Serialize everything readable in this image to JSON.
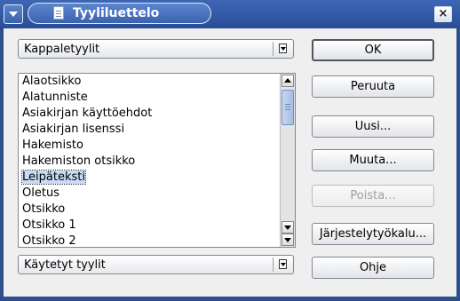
{
  "window": {
    "title": "Tyyliluettelo",
    "close_glyph": "×",
    "icons": {
      "menu": "chevron-down-icon",
      "title": "document-icon",
      "close": "close-icon"
    }
  },
  "style_family": {
    "selected": "Kappaletyylit",
    "icon": "dropdown-arrow-icon"
  },
  "style_list": {
    "items": [
      "Alaotsikko",
      "Alatunniste",
      "Asiakirjan käyttöehdot",
      "Asiakirjan lisenssi",
      "Hakemisto",
      "Hakemiston otsikko",
      "Leipäteksti",
      "Oletus",
      "Otsikko",
      "Otsikko 1",
      "Otsikko 2"
    ],
    "selected_index": 6
  },
  "style_filter": {
    "selected": "Käytetyt tyylit",
    "icon": "dropdown-arrow-icon"
  },
  "buttons": {
    "ok": "OK",
    "cancel": "Peruuta",
    "new": "Uusi...",
    "modify": "Muuta...",
    "delete": "Poista...",
    "organizer": "Järjestelytyökalu...",
    "help": "Ohje"
  },
  "colors": {
    "titlebar": "#2e4f8e",
    "dialog_bg": "#efefef",
    "selection": "#c8dcf4"
  }
}
